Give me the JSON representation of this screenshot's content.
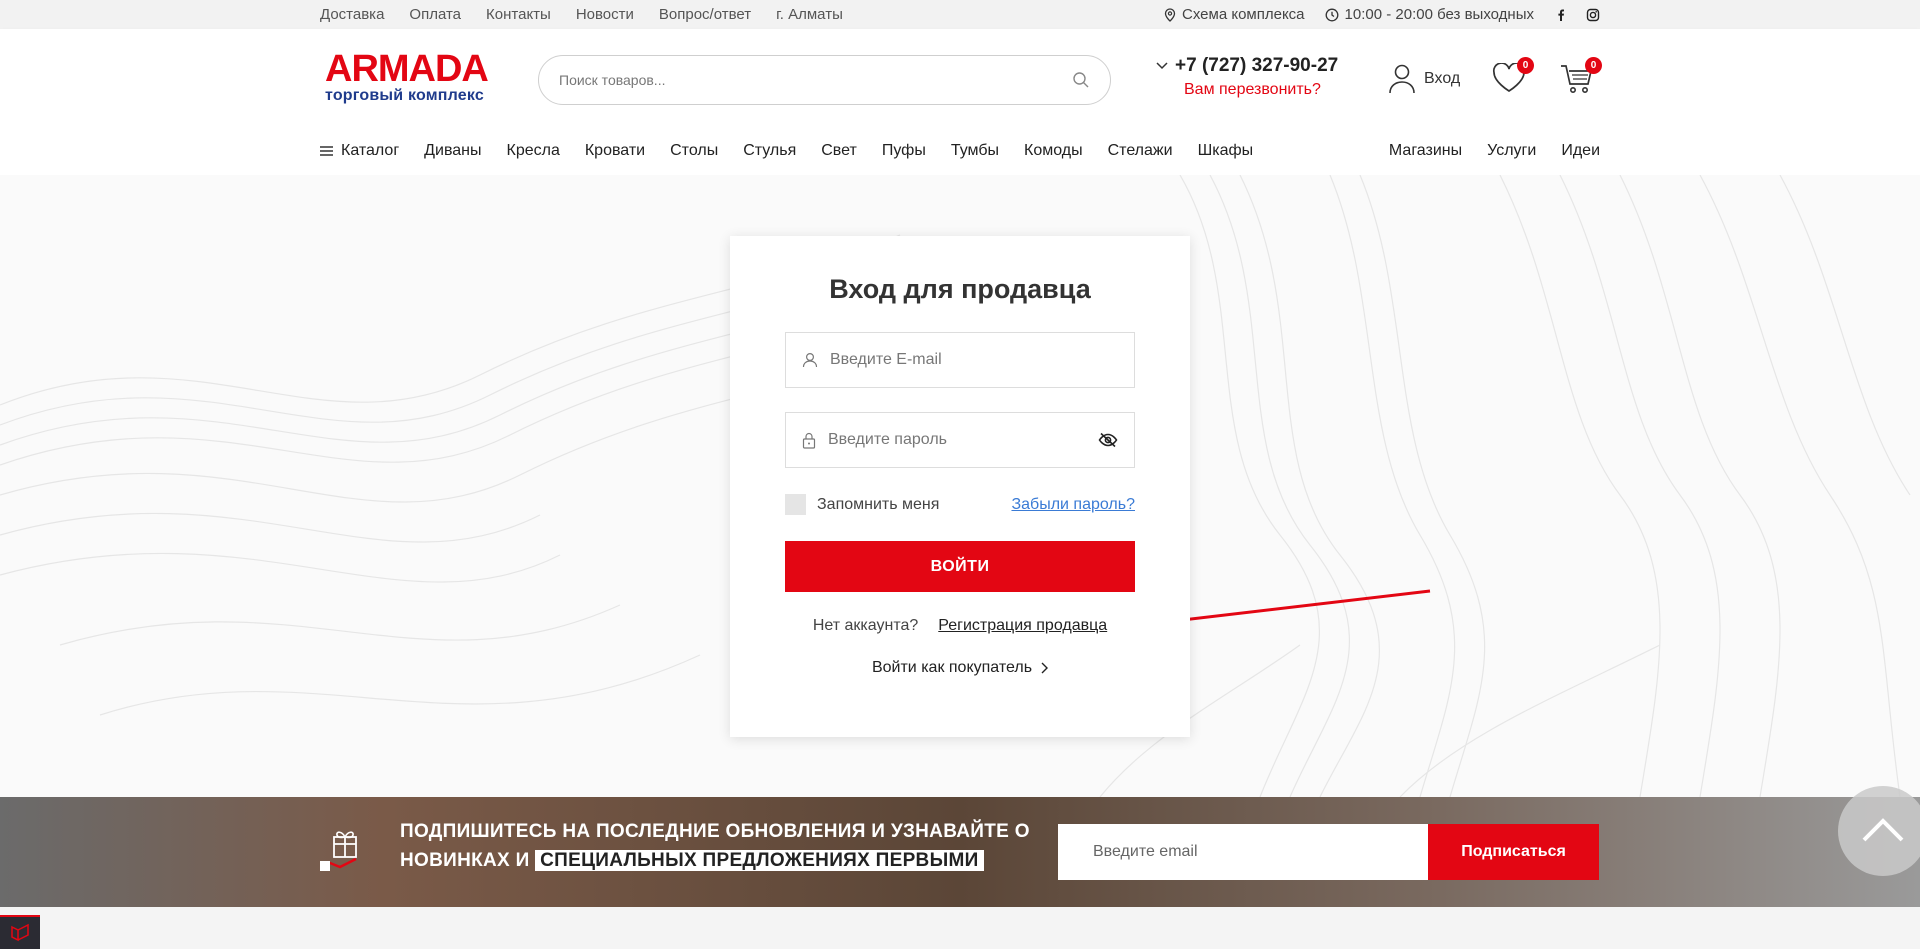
{
  "topbar": {
    "links": [
      "Доставка",
      "Оплата",
      "Контакты",
      "Новости",
      "Вопрос/ответ",
      "г. Алматы"
    ],
    "scheme": "Схема комплекса",
    "hours": "10:00 - 20:00 без выходных",
    "social": [
      "facebook-icon",
      "instagram-icon"
    ]
  },
  "header": {
    "brand": "ARMADA",
    "brand_sub": "торговый комплекс",
    "search_placeholder": "Поиск товаров...",
    "phone": "+7 (727) 327-90-27",
    "callback": "Вам перезвонить?",
    "login": "Вход",
    "fav_count": "0",
    "cart_count": "0"
  },
  "nav": {
    "catalog": "Каталог",
    "items": [
      "Диваны",
      "Кресла",
      "Кровати",
      "Столы",
      "Стулья",
      "Свет",
      "Пуфы",
      "Тумбы",
      "Комоды",
      "Стелажи",
      "Шкафы"
    ],
    "right": [
      "Магазины",
      "Услуги",
      "Идеи"
    ]
  },
  "login_card": {
    "title": "Вход для продавца",
    "email_placeholder": "Введите E-mail",
    "password_placeholder": "Введите пароль",
    "remember": "Запомнить меня",
    "forgot": "Забыли пароль?",
    "submit": "ВОЙТИ",
    "no_account": "Нет аккаунта?",
    "register": "Регистрация продавца",
    "buyer_login": "Войти как покупатель"
  },
  "subscribe": {
    "line1": "ПОДПИШИТЕСЬ НА ПОСЛЕДНИЕ ОБНОВЛЕНИЯ И УЗНАВАЙТЕ О",
    "line2_plain": "НОВИНКАХ И",
    "line2_highlight": "СПЕЦИАЛЬНЫХ ПРЕДЛОЖЕНИЯХ ПЕРВЫМИ",
    "email_placeholder": "Введите email",
    "button": "Подписаться"
  },
  "colors": {
    "accent": "#e30613",
    "brand_blue": "#1f3b8c",
    "link": "#3a7bd5"
  }
}
